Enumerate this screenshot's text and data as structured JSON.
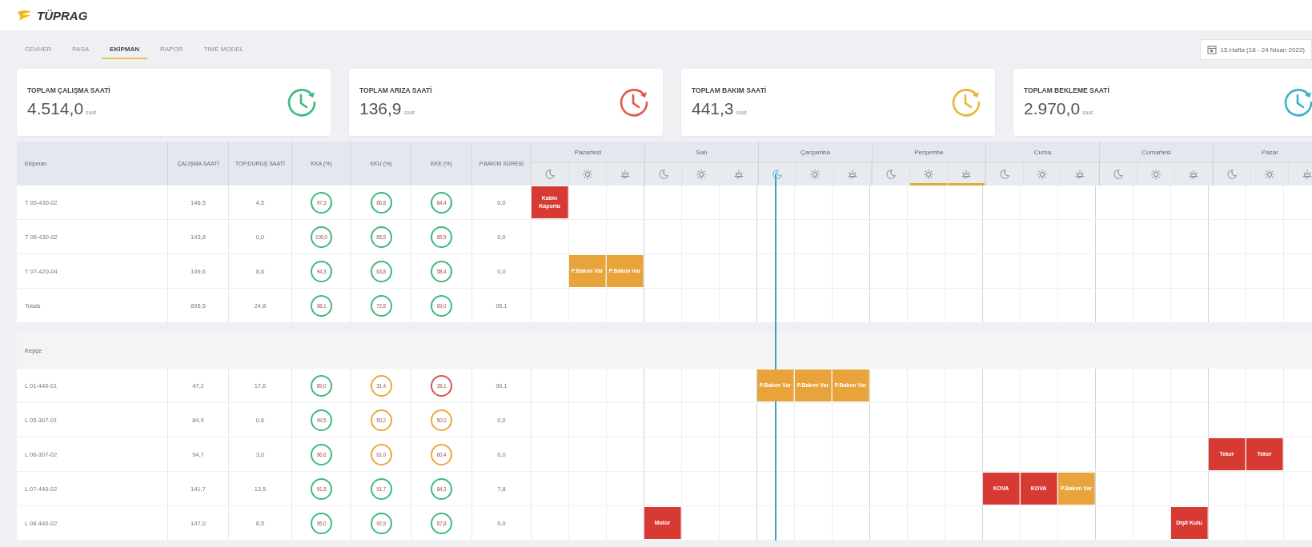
{
  "brand": {
    "name": "TÜPRAG"
  },
  "tabs": [
    {
      "label": "CEVHER",
      "selected": false
    },
    {
      "label": "PASA",
      "selected": false
    },
    {
      "label": "EKİPMAN",
      "selected": true
    },
    {
      "label": "RAPOR",
      "selected": false
    },
    {
      "label": "TIME MODEL",
      "selected": false
    }
  ],
  "date_picker": {
    "value": "15.Hafta (18 - 24 Nisan 2022)"
  },
  "summary_cards": [
    {
      "title": "TOPLAM ÇALIŞMA SAATİ",
      "value": "4.514,0",
      "unit": "saat",
      "color": "#3dba7e"
    },
    {
      "title": "TOPLAM ARIZA SAATİ",
      "value": "136,9",
      "unit": "saat",
      "color": "#e0594e"
    },
    {
      "title": "TOPLAM BAKIM SAATİ",
      "value": "441,3",
      "unit": "saat",
      "color": "#e9b33c"
    },
    {
      "title": "TOPLAM BEKLEME SAATİ",
      "value": "2.970,0",
      "unit": "saat",
      "color": "#3bb2c9"
    }
  ],
  "table": {
    "columns": [
      "Ekipman",
      "ÇALIŞMA SAATİ",
      "TOP.DURUŞ SAATİ",
      "KKA (%)",
      "KKU (%)",
      "EKE (%)",
      "P.BAKIM SÜRESİ"
    ],
    "days": [
      {
        "name": "Pazartesi",
        "shifts": [
          {
            "kind": "night",
            "current": false,
            "underlined": false
          },
          {
            "kind": "day",
            "current": false,
            "underlined": false
          },
          {
            "kind": "evening",
            "current": false,
            "underlined": false
          }
        ]
      },
      {
        "name": "Salı",
        "shifts": [
          {
            "kind": "night",
            "current": false,
            "underlined": false
          },
          {
            "kind": "day",
            "current": false,
            "underlined": false
          },
          {
            "kind": "evening",
            "current": false,
            "underlined": false
          }
        ]
      },
      {
        "name": "Çarşamba",
        "shifts": [
          {
            "kind": "night",
            "current": true,
            "underlined": false
          },
          {
            "kind": "day",
            "current": false,
            "underlined": false
          },
          {
            "kind": "evening",
            "current": false,
            "underlined": false
          }
        ]
      },
      {
        "name": "Perşembe",
        "shifts": [
          {
            "kind": "night",
            "current": false,
            "underlined": false
          },
          {
            "kind": "day",
            "current": false,
            "underlined": true
          },
          {
            "kind": "evening",
            "current": false,
            "underlined": true
          }
        ]
      },
      {
        "name": "Cuma",
        "shifts": [
          {
            "kind": "night",
            "current": false,
            "underlined": false
          },
          {
            "kind": "day",
            "current": false,
            "underlined": false
          },
          {
            "kind": "evening",
            "current": false,
            "underlined": false
          }
        ]
      },
      {
        "name": "Cumartesi",
        "shifts": [
          {
            "kind": "night",
            "current": false,
            "underlined": false
          },
          {
            "kind": "day",
            "current": false,
            "underlined": false
          },
          {
            "kind": "evening",
            "current": false,
            "underlined": false
          }
        ]
      },
      {
        "name": "Pazar",
        "shifts": [
          {
            "kind": "night",
            "current": false,
            "underlined": false
          },
          {
            "kind": "day",
            "current": false,
            "underlined": false
          },
          {
            "kind": "evening",
            "current": false,
            "underlined": false
          }
        ]
      }
    ],
    "groups": [
      {
        "rows": [
          {
            "name": "T 05-430-02",
            "work": "146,5",
            "stop": "4,5",
            "kka": {
              "value": "97,3",
              "color": "#3dba7e"
            },
            "kku": {
              "value": "86,8",
              "color": "#3dba7e"
            },
            "eke": {
              "value": "84,4",
              "color": "#3dba7e"
            },
            "pm": "0,0",
            "slots": [
              {
                "kind": "fault",
                "label": "Kabin Kaporta"
              },
              {
                "kind": "empty"
              },
              {
                "kind": "empty"
              },
              {
                "kind": "empty"
              },
              {
                "kind": "empty"
              },
              {
                "kind": "empty"
              },
              {
                "kind": "empty"
              },
              {
                "kind": "empty"
              },
              {
                "kind": "empty"
              },
              {
                "kind": "empty"
              },
              {
                "kind": "empty"
              },
              {
                "kind": "empty"
              },
              {
                "kind": "empty"
              },
              {
                "kind": "empty"
              },
              {
                "kind": "empty"
              },
              {
                "kind": "empty"
              },
              {
                "kind": "empty"
              },
              {
                "kind": "empty"
              },
              {
                "kind": "empty"
              },
              {
                "kind": "empty"
              },
              {
                "kind": "empty"
              }
            ]
          },
          {
            "name": "T 06-430-02",
            "work": "143,8",
            "stop": "0,0",
            "kka": {
              "value": "100,0",
              "color": "#3dba7e"
            },
            "kku": {
              "value": "65,5",
              "color": "#3dba7e"
            },
            "eke": {
              "value": "65,5",
              "color": "#3dba7e"
            },
            "pm": "0,0",
            "slots": [
              {
                "kind": "empty"
              },
              {
                "kind": "empty"
              },
              {
                "kind": "empty"
              },
              {
                "kind": "empty"
              },
              {
                "kind": "empty"
              },
              {
                "kind": "empty"
              },
              {
                "kind": "empty"
              },
              {
                "kind": "empty"
              },
              {
                "kind": "empty"
              },
              {
                "kind": "empty"
              },
              {
                "kind": "empty"
              },
              {
                "kind": "empty"
              },
              {
                "kind": "empty"
              },
              {
                "kind": "empty"
              },
              {
                "kind": "empty"
              },
              {
                "kind": "empty"
              },
              {
                "kind": "empty"
              },
              {
                "kind": "empty"
              },
              {
                "kind": "empty"
              },
              {
                "kind": "empty"
              },
              {
                "kind": "empty"
              }
            ]
          },
          {
            "name": "T 07-420-04",
            "work": "149,6",
            "stop": "8,6",
            "kka": {
              "value": "94,3",
              "color": "#3dba7e"
            },
            "kku": {
              "value": "63,8",
              "color": "#3dba7e"
            },
            "eke": {
              "value": "58,4",
              "color": "#3dba7e"
            },
            "pm": "0,0",
            "slots": [
              {
                "kind": "empty"
              },
              {
                "kind": "maintenance",
                "label": "P.Bakım Var"
              },
              {
                "kind": "maintenance",
                "label": "P.Bakım Var"
              },
              {
                "kind": "empty"
              },
              {
                "kind": "empty"
              },
              {
                "kind": "empty"
              },
              {
                "kind": "empty"
              },
              {
                "kind": "empty"
              },
              {
                "kind": "empty"
              },
              {
                "kind": "empty"
              },
              {
                "kind": "empty"
              },
              {
                "kind": "empty"
              },
              {
                "kind": "empty"
              },
              {
                "kind": "empty"
              },
              {
                "kind": "empty"
              },
              {
                "kind": "empty"
              },
              {
                "kind": "empty"
              },
              {
                "kind": "empty"
              },
              {
                "kind": "empty"
              },
              {
                "kind": "empty"
              },
              {
                "kind": "empty"
              }
            ]
          },
          {
            "name": "Totals",
            "work": "895,5",
            "stop": "24,8",
            "kka": {
              "value": "98,1",
              "color": "#3dba7e"
            },
            "kku": {
              "value": "72,6",
              "color": "#3dba7e"
            },
            "eke": {
              "value": "69,0",
              "color": "#3dba7e"
            },
            "pm": "95,1",
            "slots": [
              {
                "kind": "empty"
              },
              {
                "kind": "empty"
              },
              {
                "kind": "empty"
              },
              {
                "kind": "empty"
              },
              {
                "kind": "empty"
              },
              {
                "kind": "empty"
              },
              {
                "kind": "empty"
              },
              {
                "kind": "empty"
              },
              {
                "kind": "empty"
              },
              {
                "kind": "empty"
              },
              {
                "kind": "empty"
              },
              {
                "kind": "empty"
              },
              {
                "kind": "empty"
              },
              {
                "kind": "empty"
              },
              {
                "kind": "empty"
              },
              {
                "kind": "empty"
              },
              {
                "kind": "empty"
              },
              {
                "kind": "empty"
              },
              {
                "kind": "empty"
              },
              {
                "kind": "empty"
              },
              {
                "kind": "empty"
              }
            ]
          }
        ]
      },
      {
        "title": "Kepçe",
        "rows": [
          {
            "name": "L 01-440-01",
            "work": "47,2",
            "stop": "17,6",
            "kka": {
              "value": "89,0",
              "color": "#3dba7e"
            },
            "kku": {
              "value": "31,4",
              "color": "#e9a93a"
            },
            "eke": {
              "value": "28,1",
              "color": "#d9534f"
            },
            "pm": "90,1",
            "slots": [
              {
                "kind": "empty"
              },
              {
                "kind": "empty"
              },
              {
                "kind": "empty"
              },
              {
                "kind": "empty"
              },
              {
                "kind": "empty"
              },
              {
                "kind": "empty"
              },
              {
                "kind": "maintenance",
                "label": "P.Bakım Var"
              },
              {
                "kind": "maintenance",
                "label": "P.Bakım Var"
              },
              {
                "kind": "maintenance",
                "label": "P.Bakım Var"
              },
              {
                "kind": "empty"
              },
              {
                "kind": "empty"
              },
              {
                "kind": "empty"
              },
              {
                "kind": "empty"
              },
              {
                "kind": "empty"
              },
              {
                "kind": "empty"
              },
              {
                "kind": "empty"
              },
              {
                "kind": "empty"
              },
              {
                "kind": "empty"
              },
              {
                "kind": "empty"
              },
              {
                "kind": "empty"
              },
              {
                "kind": "empty"
              }
            ]
          },
          {
            "name": "L 05-307-01",
            "work": "84,9",
            "stop": "0,6",
            "kka": {
              "value": "99,5",
              "color": "#3dba7e"
            },
            "kku": {
              "value": "50,2",
              "color": "#e9a93a"
            },
            "eke": {
              "value": "50,0",
              "color": "#e9a93a"
            },
            "pm": "0,0",
            "slots": [
              {
                "kind": "empty"
              },
              {
                "kind": "empty"
              },
              {
                "kind": "empty"
              },
              {
                "kind": "empty"
              },
              {
                "kind": "empty"
              },
              {
                "kind": "empty"
              },
              {
                "kind": "empty"
              },
              {
                "kind": "empty"
              },
              {
                "kind": "empty"
              },
              {
                "kind": "empty"
              },
              {
                "kind": "empty"
              },
              {
                "kind": "empty"
              },
              {
                "kind": "empty"
              },
              {
                "kind": "empty"
              },
              {
                "kind": "empty"
              },
              {
                "kind": "empty"
              },
              {
                "kind": "empty"
              },
              {
                "kind": "empty"
              },
              {
                "kind": "empty"
              },
              {
                "kind": "empty"
              },
              {
                "kind": "empty"
              }
            ]
          },
          {
            "name": "L 06-307-02",
            "work": "94,7",
            "stop": "3,0",
            "kka": {
              "value": "96,6",
              "color": "#3dba7e"
            },
            "kku": {
              "value": "61,0",
              "color": "#e9a93a"
            },
            "eke": {
              "value": "60,4",
              "color": "#e9a93a"
            },
            "pm": "0,0",
            "slots": [
              {
                "kind": "empty"
              },
              {
                "kind": "empty"
              },
              {
                "kind": "empty"
              },
              {
                "kind": "empty"
              },
              {
                "kind": "empty"
              },
              {
                "kind": "empty"
              },
              {
                "kind": "empty"
              },
              {
                "kind": "empty"
              },
              {
                "kind": "empty"
              },
              {
                "kind": "empty"
              },
              {
                "kind": "empty"
              },
              {
                "kind": "empty"
              },
              {
                "kind": "empty"
              },
              {
                "kind": "empty"
              },
              {
                "kind": "empty"
              },
              {
                "kind": "empty"
              },
              {
                "kind": "empty"
              },
              {
                "kind": "empty"
              },
              {
                "kind": "fault",
                "label": "Teker"
              },
              {
                "kind": "fault",
                "label": "Teker"
              },
              {
                "kind": "empty"
              }
            ]
          },
          {
            "name": "L 07-440-02",
            "work": "141,7",
            "stop": "13,5",
            "kka": {
              "value": "91,8",
              "color": "#3dba7e"
            },
            "kku": {
              "value": "91,7",
              "color": "#3dba7e"
            },
            "eke": {
              "value": "84,3",
              "color": "#3dba7e"
            },
            "pm": "7,8",
            "slots": [
              {
                "kind": "empty"
              },
              {
                "kind": "empty"
              },
              {
                "kind": "empty"
              },
              {
                "kind": "empty"
              },
              {
                "kind": "empty"
              },
              {
                "kind": "empty"
              },
              {
                "kind": "empty"
              },
              {
                "kind": "empty"
              },
              {
                "kind": "empty"
              },
              {
                "kind": "empty"
              },
              {
                "kind": "empty"
              },
              {
                "kind": "empty"
              },
              {
                "kind": "fault",
                "label": "KOVA"
              },
              {
                "kind": "fault",
                "label": "KOVA"
              },
              {
                "kind": "maintenance",
                "label": "P.Bakım Var"
              },
              {
                "kind": "empty"
              },
              {
                "kind": "empty"
              },
              {
                "kind": "empty"
              },
              {
                "kind": "empty"
              },
              {
                "kind": "empty"
              },
              {
                "kind": "empty"
              }
            ]
          },
          {
            "name": "L 08-440-02",
            "work": "147,0",
            "stop": "8,5",
            "kka": {
              "value": "95,0",
              "color": "#3dba7e"
            },
            "kku": {
              "value": "92,9",
              "color": "#3dba7e"
            },
            "eke": {
              "value": "87,8",
              "color": "#3dba7e"
            },
            "pm": "0,0",
            "slots": [
              {
                "kind": "empty"
              },
              {
                "kind": "empty"
              },
              {
                "kind": "empty"
              },
              {
                "kind": "fault",
                "label": "Motor"
              },
              {
                "kind": "empty"
              },
              {
                "kind": "empty"
              },
              {
                "kind": "empty"
              },
              {
                "kind": "empty"
              },
              {
                "kind": "empty"
              },
              {
                "kind": "empty"
              },
              {
                "kind": "empty"
              },
              {
                "kind": "empty"
              },
              {
                "kind": "empty"
              },
              {
                "kind": "empty"
              },
              {
                "kind": "empty"
              },
              {
                "kind": "empty"
              },
              {
                "kind": "empty"
              },
              {
                "kind": "fault",
                "label": "Dişli Kutu"
              },
              {
                "kind": "empty"
              },
              {
                "kind": "empty"
              },
              {
                "kind": "empty"
              }
            ]
          }
        ]
      }
    ]
  }
}
